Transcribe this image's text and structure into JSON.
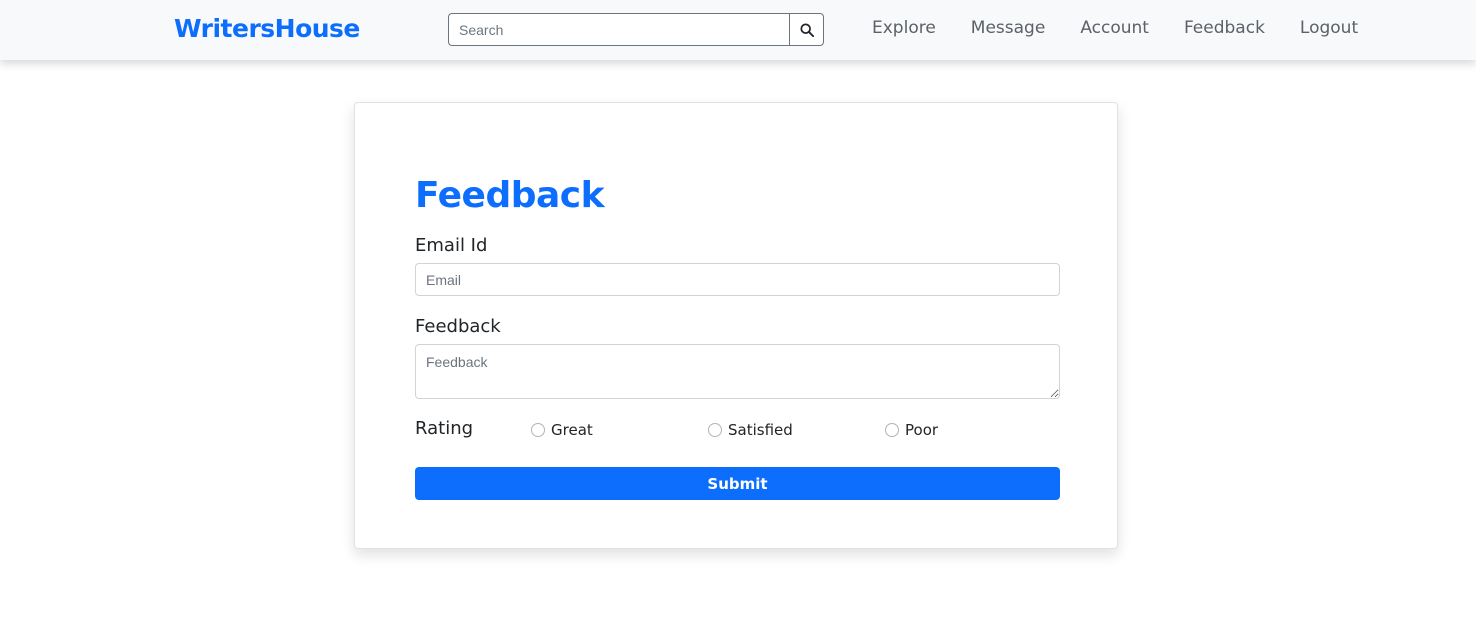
{
  "navbar": {
    "brand": "WritersHouse",
    "search_placeholder": "Search",
    "links": [
      "Explore",
      "Message",
      "Account",
      "Feedback",
      "Logout"
    ]
  },
  "form": {
    "title": "Feedback",
    "email_label": "Email Id",
    "email_placeholder": "Email",
    "feedback_label": "Feedback",
    "feedback_placeholder": "Feedback",
    "rating_label": "Rating",
    "rating_options": [
      "Great",
      "Satisfied",
      "Poor"
    ],
    "submit_label": "Submit"
  },
  "colors": {
    "primary": "#0d6efd",
    "navbar_bg": "#f8f9fa"
  }
}
